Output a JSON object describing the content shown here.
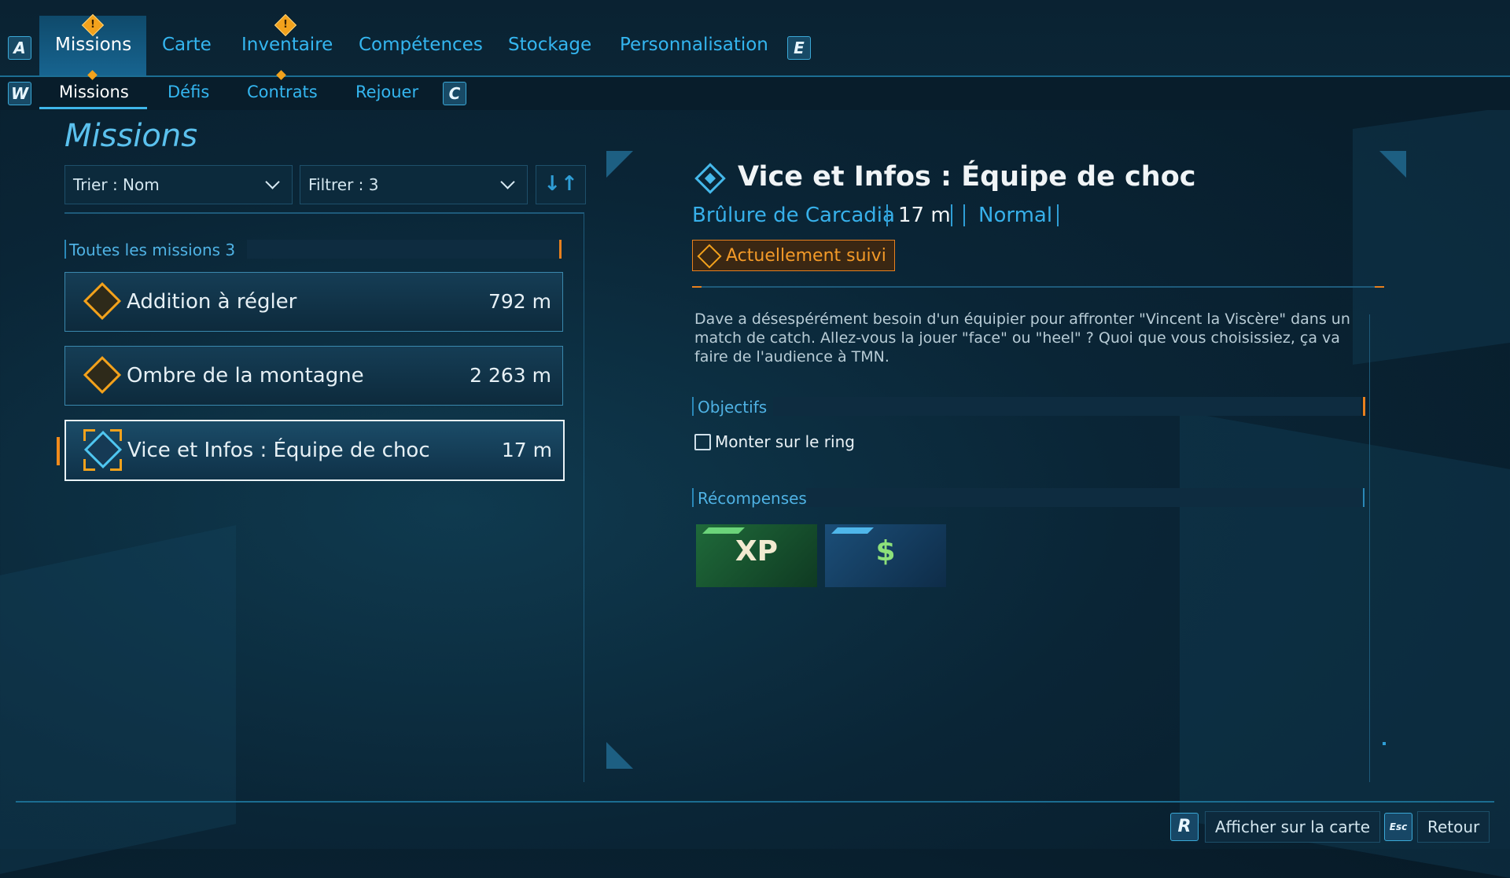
{
  "nav": {
    "left_key": "A",
    "right_key": "E",
    "tabs": [
      {
        "label": "Missions",
        "active": true,
        "alert": true
      },
      {
        "label": "Carte"
      },
      {
        "label": "Inventaire",
        "alert": true
      },
      {
        "label": "Compétences"
      },
      {
        "label": "Stockage"
      },
      {
        "label": "Personnalisation"
      }
    ],
    "alert_glyph": "!"
  },
  "subnav": {
    "left_key": "W",
    "right_key": "C",
    "tabs": [
      {
        "label": "Missions",
        "active": true
      },
      {
        "label": "Défis"
      },
      {
        "label": "Contrats"
      },
      {
        "label": "Rejouer"
      }
    ]
  },
  "list": {
    "title": "Missions",
    "sort_label": "Trier : Nom",
    "filter_label": "Filtrer : 3",
    "sort_icon": "↓↑",
    "section_label": "Toutes les missions 3",
    "missions": [
      {
        "name": "Addition à régler",
        "distance": "792 m",
        "icon": "gig-diamond-icon"
      },
      {
        "name": "Ombre de la montagne",
        "distance": "2 263 m",
        "icon": "gig-diamond-icon"
      },
      {
        "name": "Vice et Infos : Équipe de choc",
        "distance": "17 m",
        "icon": "tracked-mission-icon",
        "selected": true
      }
    ]
  },
  "detail": {
    "title": "Vice et Infos : Équipe de choc",
    "location": "Brûlure de Carcadia",
    "distance": "17 m",
    "difficulty": "Normal",
    "status": "Actuellement suivi",
    "description": "Dave a désespérément besoin d'un équipier pour affronter \"Vincent la Viscère\" dans un match de catch. Allez-vous la jouer \"face\" ou \"heel\" ? Quoi que vous choisissiez, ça va faire de l'audience à TMN.",
    "objectives_label": "Objectifs",
    "objectives": [
      {
        "label": "Monter sur le ring",
        "done": false
      }
    ],
    "rewards_label": "Récompenses",
    "rewards": [
      {
        "type": "xp",
        "glyph": "XP",
        "color": "#1f6a3a"
      },
      {
        "type": "cash",
        "glyph": "$",
        "color": "#1b4e78"
      }
    ]
  },
  "footer": {
    "map_key": "R",
    "map_label": "Afficher sur la carte",
    "back_key": "Esc",
    "back_label": "Retour"
  },
  "colors": {
    "accent": "#34b6f0",
    "alert": "#f3a21c",
    "tracked": "#e8801e"
  }
}
